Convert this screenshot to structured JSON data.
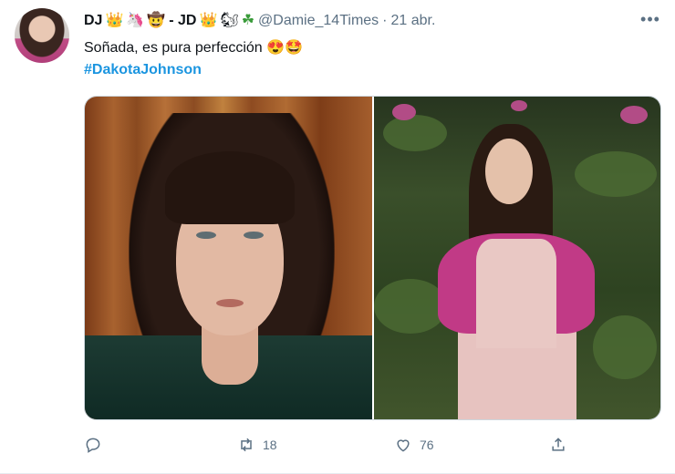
{
  "tweet": {
    "display_name_part1": "DJ",
    "emojis_part1": [
      "👑",
      "🦄",
      "🤠"
    ],
    "separator": "- JD",
    "emojis_part2": [
      "👑",
      "🐿",
      "☘"
    ],
    "handle": "@Damie_14Times",
    "dot": "·",
    "date": "21 abr.",
    "text": "Soñada, es pura perfección 😍🤩",
    "hashtag": "#DakotaJohnson",
    "more_label": "•••"
  },
  "actions": {
    "reply_count": "",
    "retweet_count": "18",
    "like_count": "76",
    "share_count": ""
  },
  "icons": {
    "more": "more-horizontal-icon",
    "reply": "reply-icon",
    "retweet": "retweet-icon",
    "like": "heart-icon",
    "share": "share-icon"
  },
  "colors": {
    "accent": "#1b95e0",
    "secondary_text": "#5b7083",
    "primary_text": "#0f1419"
  }
}
